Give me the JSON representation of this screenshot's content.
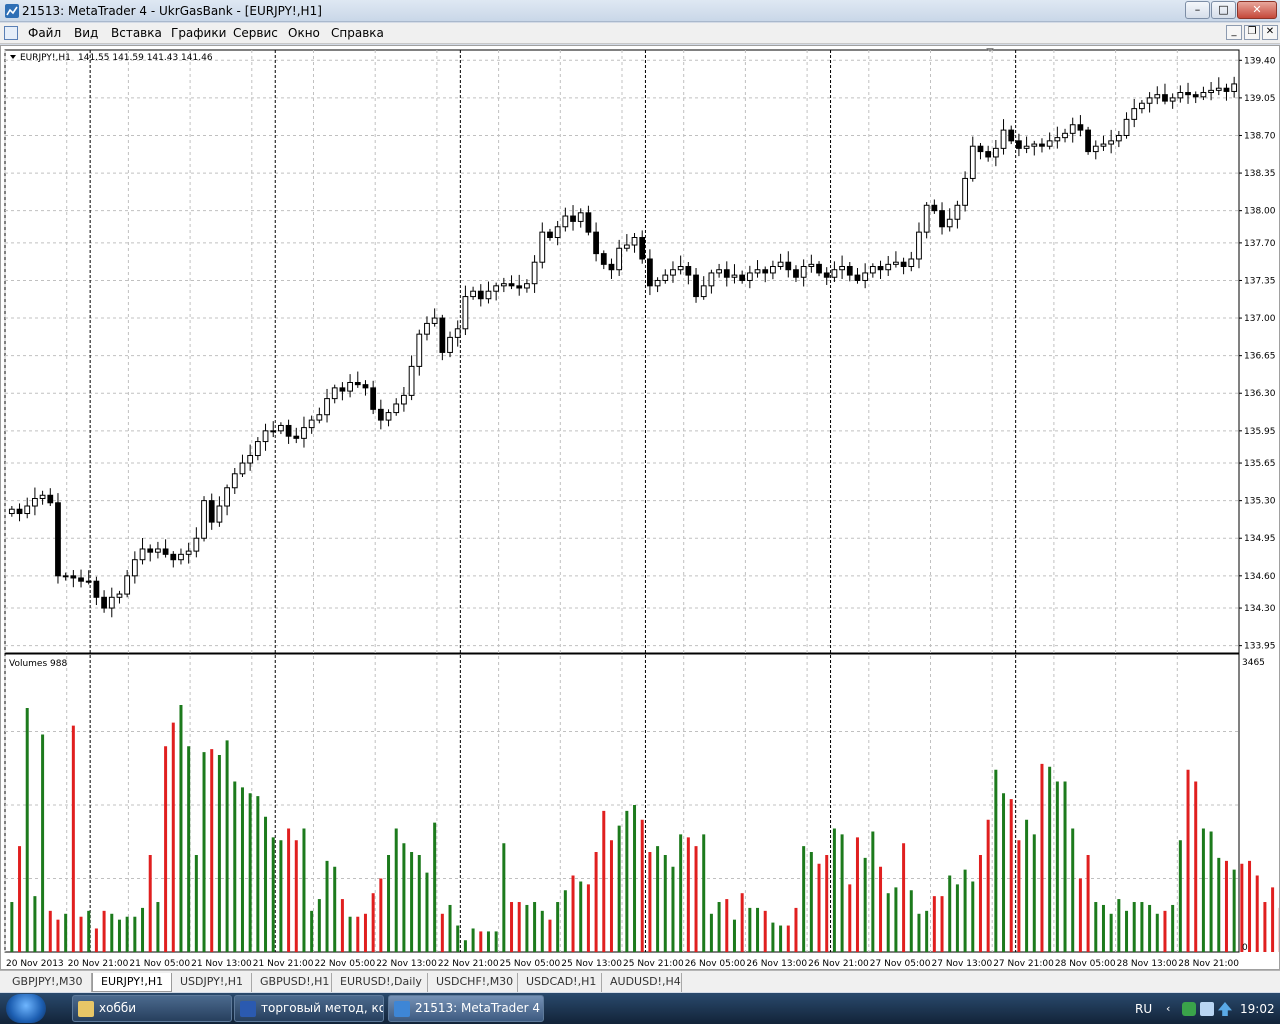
{
  "window": {
    "title": "21513: MetaTrader 4 - UkrGasBank - [EURJPY!,H1]",
    "controls": {
      "minimize": "–",
      "maximize": "□",
      "close": "✕"
    },
    "mdi_controls": {
      "minimize": "_",
      "restore": "❐",
      "close": "✕"
    }
  },
  "menu": [
    "Файл",
    "Вид",
    "Вставка",
    "Графики",
    "Сервис",
    "Окно",
    "Справка"
  ],
  "chart_header": {
    "symbol_label": "EURJPY!,H1",
    "ohlc": "141.55 141.59 141.43 141.46",
    "volumes_label": "Volumes 988"
  },
  "chart_data": {
    "type": "candlestick",
    "price_axis": {
      "labels": [
        "139.40",
        "139.05",
        "138.70",
        "138.35",
        "138.00",
        "137.70",
        "137.35",
        "137.00",
        "136.65",
        "136.30",
        "135.95",
        "135.65",
        "135.30",
        "134.95",
        "134.60",
        "134.30",
        "133.95"
      ],
      "values": [
        139.4,
        139.05,
        138.7,
        138.35,
        138.0,
        137.7,
        137.35,
        137.0,
        136.65,
        136.3,
        135.95,
        135.65,
        135.3,
        134.95,
        134.6,
        134.3,
        133.95
      ],
      "ylim": [
        133.9,
        139.44
      ]
    },
    "volume_axis": {
      "max_label": "3465",
      "min_label": "0",
      "ylim": [
        0,
        3465
      ]
    },
    "time_labels": [
      "20 Nov 2013",
      "20 Nov 21:00",
      "21 Nov 05:00",
      "21 Nov 13:00",
      "21 Nov 21:00",
      "22 Nov 05:00",
      "22 Nov 13:00",
      "22 Nov 21:00",
      "25 Nov 05:00",
      "25 Nov 13:00",
      "25 Nov 21:00",
      "26 Nov 05:00",
      "26 Nov 13:00",
      "26 Nov 21:00",
      "27 Nov 05:00",
      "27 Nov 13:00",
      "27 Nov 21:00",
      "28 Nov 05:00",
      "28 Nov 13:00",
      "28 Nov 21:00"
    ],
    "grid": true,
    "close_path": [
      135.22,
      135.18,
      135.25,
      135.32,
      135.35,
      135.28,
      134.6,
      134.6,
      134.58,
      134.55,
      134.55,
      134.4,
      134.3,
      134.4,
      134.43,
      134.6,
      134.75,
      134.85,
      134.82,
      134.85,
      134.8,
      134.75,
      134.8,
      134.83,
      134.95,
      135.3,
      135.1,
      135.25,
      135.42,
      135.55,
      135.65,
      135.72,
      135.85,
      135.95,
      135.95,
      136.0,
      135.9,
      135.88,
      135.98,
      136.05,
      136.1,
      136.25,
      136.35,
      136.32,
      136.4,
      136.38,
      136.35,
      136.15,
      136.05,
      136.12,
      136.2,
      136.28,
      136.55,
      136.85,
      136.95,
      137.0,
      136.68,
      136.82,
      136.9,
      137.2,
      137.25,
      137.18,
      137.25,
      137.3,
      137.32,
      137.3,
      137.28,
      137.32,
      137.52,
      137.8,
      137.75,
      137.85,
      137.95,
      137.9,
      137.98,
      137.8,
      137.6,
      137.5,
      137.45,
      137.65,
      137.68,
      137.75,
      137.55,
      137.3,
      137.35,
      137.4,
      137.45,
      137.48,
      137.4,
      137.2,
      137.3,
      137.42,
      137.45,
      137.38,
      137.4,
      137.35,
      137.42,
      137.45,
      137.42,
      137.48,
      137.52,
      137.45,
      137.38,
      137.48,
      137.5,
      137.42,
      137.38,
      137.45,
      137.48,
      137.4,
      137.35,
      137.42,
      137.48,
      137.45,
      137.5,
      137.52,
      137.48,
      137.55,
      137.8,
      138.05,
      138.0,
      137.85,
      137.92,
      138.05,
      138.3,
      138.6,
      138.55,
      138.5,
      138.58,
      138.75,
      138.65,
      138.58,
      138.6,
      138.62,
      138.6,
      138.65,
      138.68,
      138.72,
      138.8,
      138.75,
      138.55,
      138.6,
      138.62,
      138.65,
      138.7,
      138.85,
      138.95,
      139.0,
      139.05,
      139.08,
      139.02,
      139.05,
      139.1,
      139.08,
      139.06,
      139.1,
      139.12,
      139.14,
      139.11,
      139.18
    ],
    "volume_heights": [
      0.17,
      0.36,
      0.83,
      0.19,
      0.74,
      0.14,
      0.11,
      0.13,
      0.77,
      0.12,
      0.14,
      0.08,
      0.14,
      0.13,
      0.11,
      0.12,
      0.12,
      0.15,
      0.33,
      0.17,
      0.7,
      0.78,
      0.84,
      0.7,
      0.33,
      0.68,
      0.69,
      0.67,
      0.72,
      0.58,
      0.56,
      0.54,
      0.53,
      0.46,
      0.39,
      0.38,
      0.42,
      0.38,
      0.42,
      0.14,
      0.18,
      0.31,
      0.29,
      0.18,
      0.12,
      0.12,
      0.13,
      0.2,
      0.25,
      0.33,
      0.42,
      0.37,
      0.34,
      0.33,
      0.27,
      0.44,
      0.13,
      0.16,
      0.09,
      0.04,
      0.08,
      0.07,
      0.07,
      0.07,
      0.37,
      0.17,
      0.17,
      0.16,
      0.17,
      0.14,
      0.11,
      0.17,
      0.21,
      0.26,
      0.24,
      0.23,
      0.34,
      0.48,
      0.38,
      0.43,
      0.48,
      0.5,
      0.45,
      0.34,
      0.36,
      0.33,
      0.29,
      0.4,
      0.39,
      0.36,
      0.4,
      0.13,
      0.17,
      0.18,
      0.11,
      0.2,
      0.15,
      0.15,
      0.14,
      0.1,
      0.09,
      0.09,
      0.15,
      0.36,
      0.34,
      0.3,
      0.33,
      0.42,
      0.4,
      0.23,
      0.39,
      0.32,
      0.41,
      0.29,
      0.2,
      0.22,
      0.37,
      0.21,
      0.13,
      0.14,
      0.19,
      0.19,
      0.26,
      0.23,
      0.28,
      0.24,
      0.33,
      0.45,
      0.62,
      0.54,
      0.52,
      0.38,
      0.45,
      0.4,
      0.64,
      0.63,
      0.58,
      0.58,
      0.42,
      0.25,
      0.33,
      0.17,
      0.16,
      0.13,
      0.18,
      0.14,
      0.17,
      0.17,
      0.16,
      0.13,
      0.14,
      0.16,
      0.38,
      0.62,
      0.58,
      0.42,
      0.41,
      0.32,
      0.31,
      0.28,
      0.3,
      0.31,
      0.26,
      0.17,
      0.22,
      0.15,
      0.12,
      0.19
    ],
    "colors": {
      "bull_volume": "#1c7a1c",
      "bear_volume": "#e01f1f",
      "grid": "#c0c0c0",
      "candle": "#000000"
    }
  },
  "tabs": [
    {
      "label": "GBPJPY!,M30",
      "active": false
    },
    {
      "label": "EURJPY!,H1",
      "active": true
    },
    {
      "label": "USDJPY!,H1",
      "active": false
    },
    {
      "label": "GBPUSD!,H1",
      "active": false
    },
    {
      "label": "EURUSD!,Daily",
      "active": false
    },
    {
      "label": "USDCHF!,M30",
      "active": false
    },
    {
      "label": "USDCAD!,H1",
      "active": false
    },
    {
      "label": "AUDUSD!,H4",
      "active": false
    }
  ],
  "taskbar": {
    "items": [
      {
        "label": "хобби",
        "icon": "folder-icon",
        "active": false
      },
      {
        "label": "торговый метод, ко...",
        "icon": "word-icon",
        "active": false
      },
      {
        "label": "21513: MetaTrader 4 ...",
        "icon": "metatrader-icon",
        "active": true
      }
    ],
    "language": "RU",
    "clock": "19:02"
  }
}
